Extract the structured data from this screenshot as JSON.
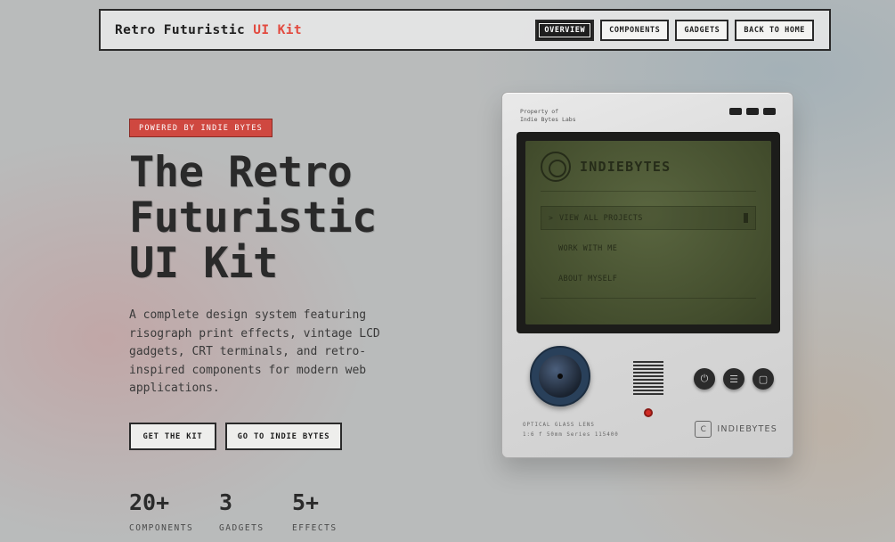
{
  "header": {
    "brand_main": "Retro Futuristic",
    "brand_accent": "UI Kit",
    "nav": [
      {
        "label": "OVERVIEW",
        "active": true
      },
      {
        "label": "COMPONENTS",
        "active": false
      },
      {
        "label": "GADGETS",
        "active": false
      },
      {
        "label": "BACK TO HOME",
        "active": false
      }
    ]
  },
  "hero": {
    "badge": "POWERED BY INDIE BYTES",
    "title_lines": [
      "The Retro",
      "Futuristic",
      "UI Kit"
    ],
    "description": "A complete design system featuring risograph print effects, vintage LCD gadgets, CRT terminals, and retro-inspired components for modern web applications.",
    "cta_primary": "GET THE KIT",
    "cta_secondary": "GO TO INDIE BYTES",
    "stats": [
      {
        "value": "20+",
        "label": "COMPONENTS"
      },
      {
        "value": "3",
        "label": "GADGETS"
      },
      {
        "value": "5+",
        "label": "EFFECTS"
      }
    ]
  },
  "device": {
    "property_line1": "Property of",
    "property_line2": "Indie Bytes Labs",
    "screen_title": "INDIEBYTES",
    "menu": [
      {
        "label": "VIEW ALL PROJECTS",
        "selected": true,
        "caret": ">"
      },
      {
        "label": "WORK WITH ME",
        "selected": false
      },
      {
        "label": "ABOUT MYSELF",
        "selected": false
      }
    ],
    "lens_line1": "OPTICAL GLASS LENS",
    "lens_line2": "1:6 f 50mm Series 115400",
    "brand_letter": "C",
    "brand_name": "INDIEBYTES",
    "buttons": [
      {
        "icon": "power-icon",
        "glyph": "⏻"
      },
      {
        "icon": "menu-icon",
        "glyph": "☰"
      },
      {
        "icon": "square-icon",
        "glyph": "▢"
      }
    ]
  },
  "colors": {
    "accent": "#e24a3f",
    "badge": "#cf4840",
    "lcd": "#4a5533",
    "knob": "#29405a"
  }
}
